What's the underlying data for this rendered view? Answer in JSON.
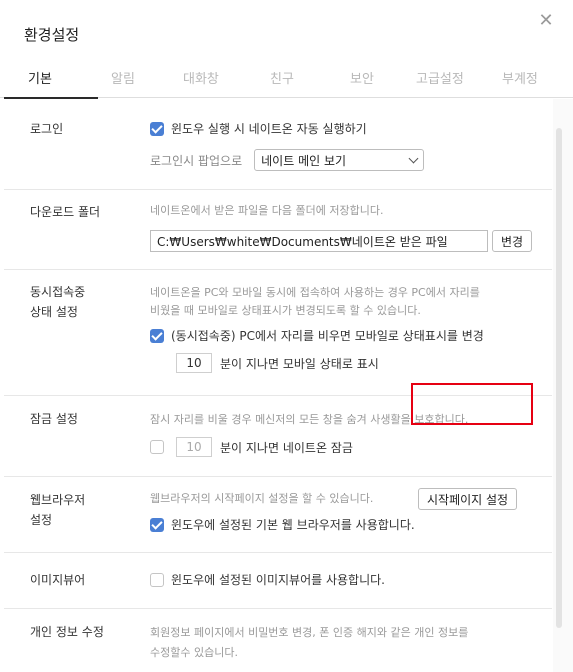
{
  "window": {
    "title": "환경설정",
    "close_glyph": "✕"
  },
  "tabs": [
    {
      "label": "기본",
      "active": true
    },
    {
      "label": "알림",
      "active": false
    },
    {
      "label": "대화창",
      "active": false
    },
    {
      "label": "친구",
      "active": false
    },
    {
      "label": "보안",
      "active": false
    },
    {
      "label": "고급설정",
      "active": false
    },
    {
      "label": "부계정",
      "active": false
    }
  ],
  "sections": {
    "login": {
      "label": "로그인",
      "auto_run": {
        "label": "윈도우 실행 시 네이트온 자동 실행하기",
        "checked": true
      },
      "popup_label": "로그인시 팝업으로",
      "popup_select": "네이트 메인 보기"
    },
    "download": {
      "label": "다운로드 폴더",
      "desc": "네이트온에서 받은 파일을 다음 폴더에 저장합니다.",
      "path": "C:₩Users₩white₩Documents₩네이트온 받은 파일",
      "change_btn": "변경"
    },
    "concurrent": {
      "label_line1": "동시접속중",
      "label_line2": "상태 설정",
      "desc_line1": "네이트온을 PC와 모바일 동시에 접속하여 사용하는 경우 PC에서 자리를",
      "desc_line2": "비웠을 때 모바일로 상태표시가 변경되도록 할 수 있습니다.",
      "option": {
        "label": "(동시접속중) PC에서 자리를 비우면 모바일로 상태표시를 변경",
        "checked": true
      },
      "minutes": "10",
      "minutes_suffix": "분이 지나면 모바일 상태로 표시"
    },
    "lock": {
      "label": "잠금 설정",
      "desc": "잠시 자리를 비울 경우 메신저의 모든 창을 숨겨 사생활을 보호합니다.",
      "checked": false,
      "minutes": "10",
      "minutes_suffix": "분이 지나면 네이트온 잠금"
    },
    "browser": {
      "label_line1": "웹브라우저",
      "label_line2": "설정",
      "desc": "웹브라우저의 시작페이지 설정을 할 수 있습니다.",
      "start_btn": "시작페이지 설정",
      "option": {
        "label": "윈도우에 설정된 기본 웹 브라우저를 사용합니다.",
        "checked": true
      }
    },
    "image_viewer": {
      "label": "이미지뷰어",
      "option": {
        "label": "윈도우에 설정된 이미지뷰어를 사용합니다.",
        "checked": false
      }
    },
    "privacy": {
      "label": "개인 정보 수정",
      "desc_line1": "회원정보 페이지에서 비밀번호 변경, 폰 인증 해지와 같은 개인 정보를",
      "desc_line2": "수정할수 있습니다."
    }
  },
  "colors": {
    "accent": "#4a7fd4",
    "highlight": "#e60012"
  }
}
